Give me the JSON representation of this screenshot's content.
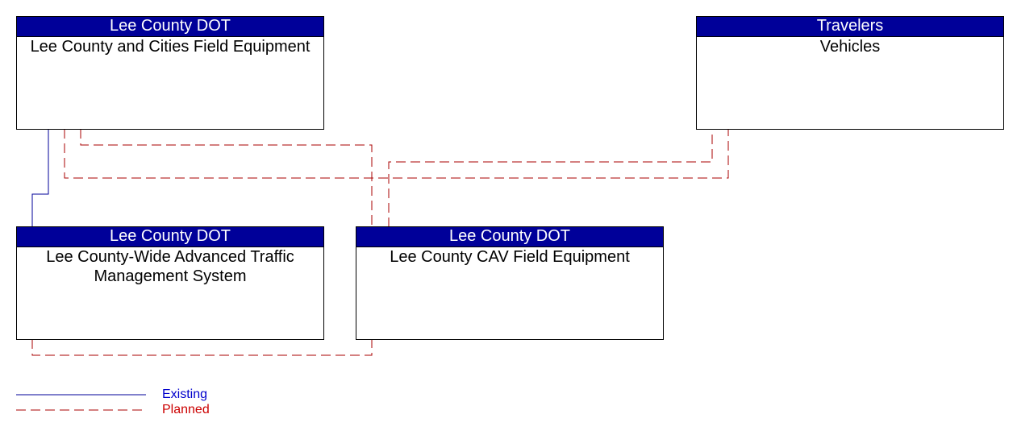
{
  "nodes": [
    {
      "id": "field",
      "owner": "Lee County DOT",
      "name": "Lee County and Cities Field Equipment"
    },
    {
      "id": "vehicles",
      "owner": "Travelers",
      "name": "Vehicles"
    },
    {
      "id": "atms",
      "owner": "Lee County DOT",
      "name": "Lee County-Wide Advanced Traffic Management System"
    },
    {
      "id": "cav",
      "owner": "Lee County DOT",
      "name": "Lee County CAV Field Equipment"
    }
  ],
  "links": [
    {
      "from": "field",
      "to": "atms",
      "status": "existing"
    },
    {
      "from": "field",
      "to": "cav",
      "status": "planned"
    },
    {
      "from": "field",
      "to": "vehicles",
      "status": "planned"
    },
    {
      "from": "cav",
      "to": "vehicles",
      "status": "planned"
    },
    {
      "from": "atms",
      "to": "cav",
      "status": "planned"
    }
  ],
  "legend": {
    "existing": {
      "label": "Existing",
      "color": "#000099"
    },
    "planned": {
      "label": "Planned",
      "color": "#aa0000"
    }
  }
}
